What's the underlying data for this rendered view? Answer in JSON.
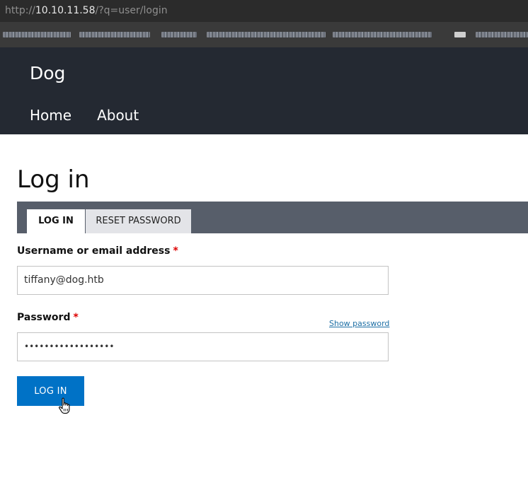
{
  "browser": {
    "url_prefix": "http://",
    "url_host": "10.10.11.58",
    "url_path": "/?q=user/login"
  },
  "site": {
    "name": "Dog",
    "nav": [
      {
        "label": "Home"
      },
      {
        "label": "About"
      }
    ]
  },
  "page": {
    "title": "Log in",
    "tabs": [
      {
        "label": "LOG IN",
        "active": true
      },
      {
        "label": "RESET PASSWORD",
        "active": false
      }
    ]
  },
  "form": {
    "username": {
      "label": "Username or email address",
      "required_mark": "*",
      "value": "tiffany@dog.htb"
    },
    "password": {
      "label": "Password",
      "required_mark": "*",
      "masked_value": "••••••••••••••••••",
      "show_password_link": "Show password"
    },
    "submit_label": "LOG IN"
  },
  "colors": {
    "header_bg": "#242932",
    "tabs_bar_bg": "#575e6a",
    "button_bg": "#0072c6",
    "required": "#dd0000",
    "link": "#1d6fa5"
  },
  "icons": {
    "cursor": "hand-pointer-icon"
  }
}
